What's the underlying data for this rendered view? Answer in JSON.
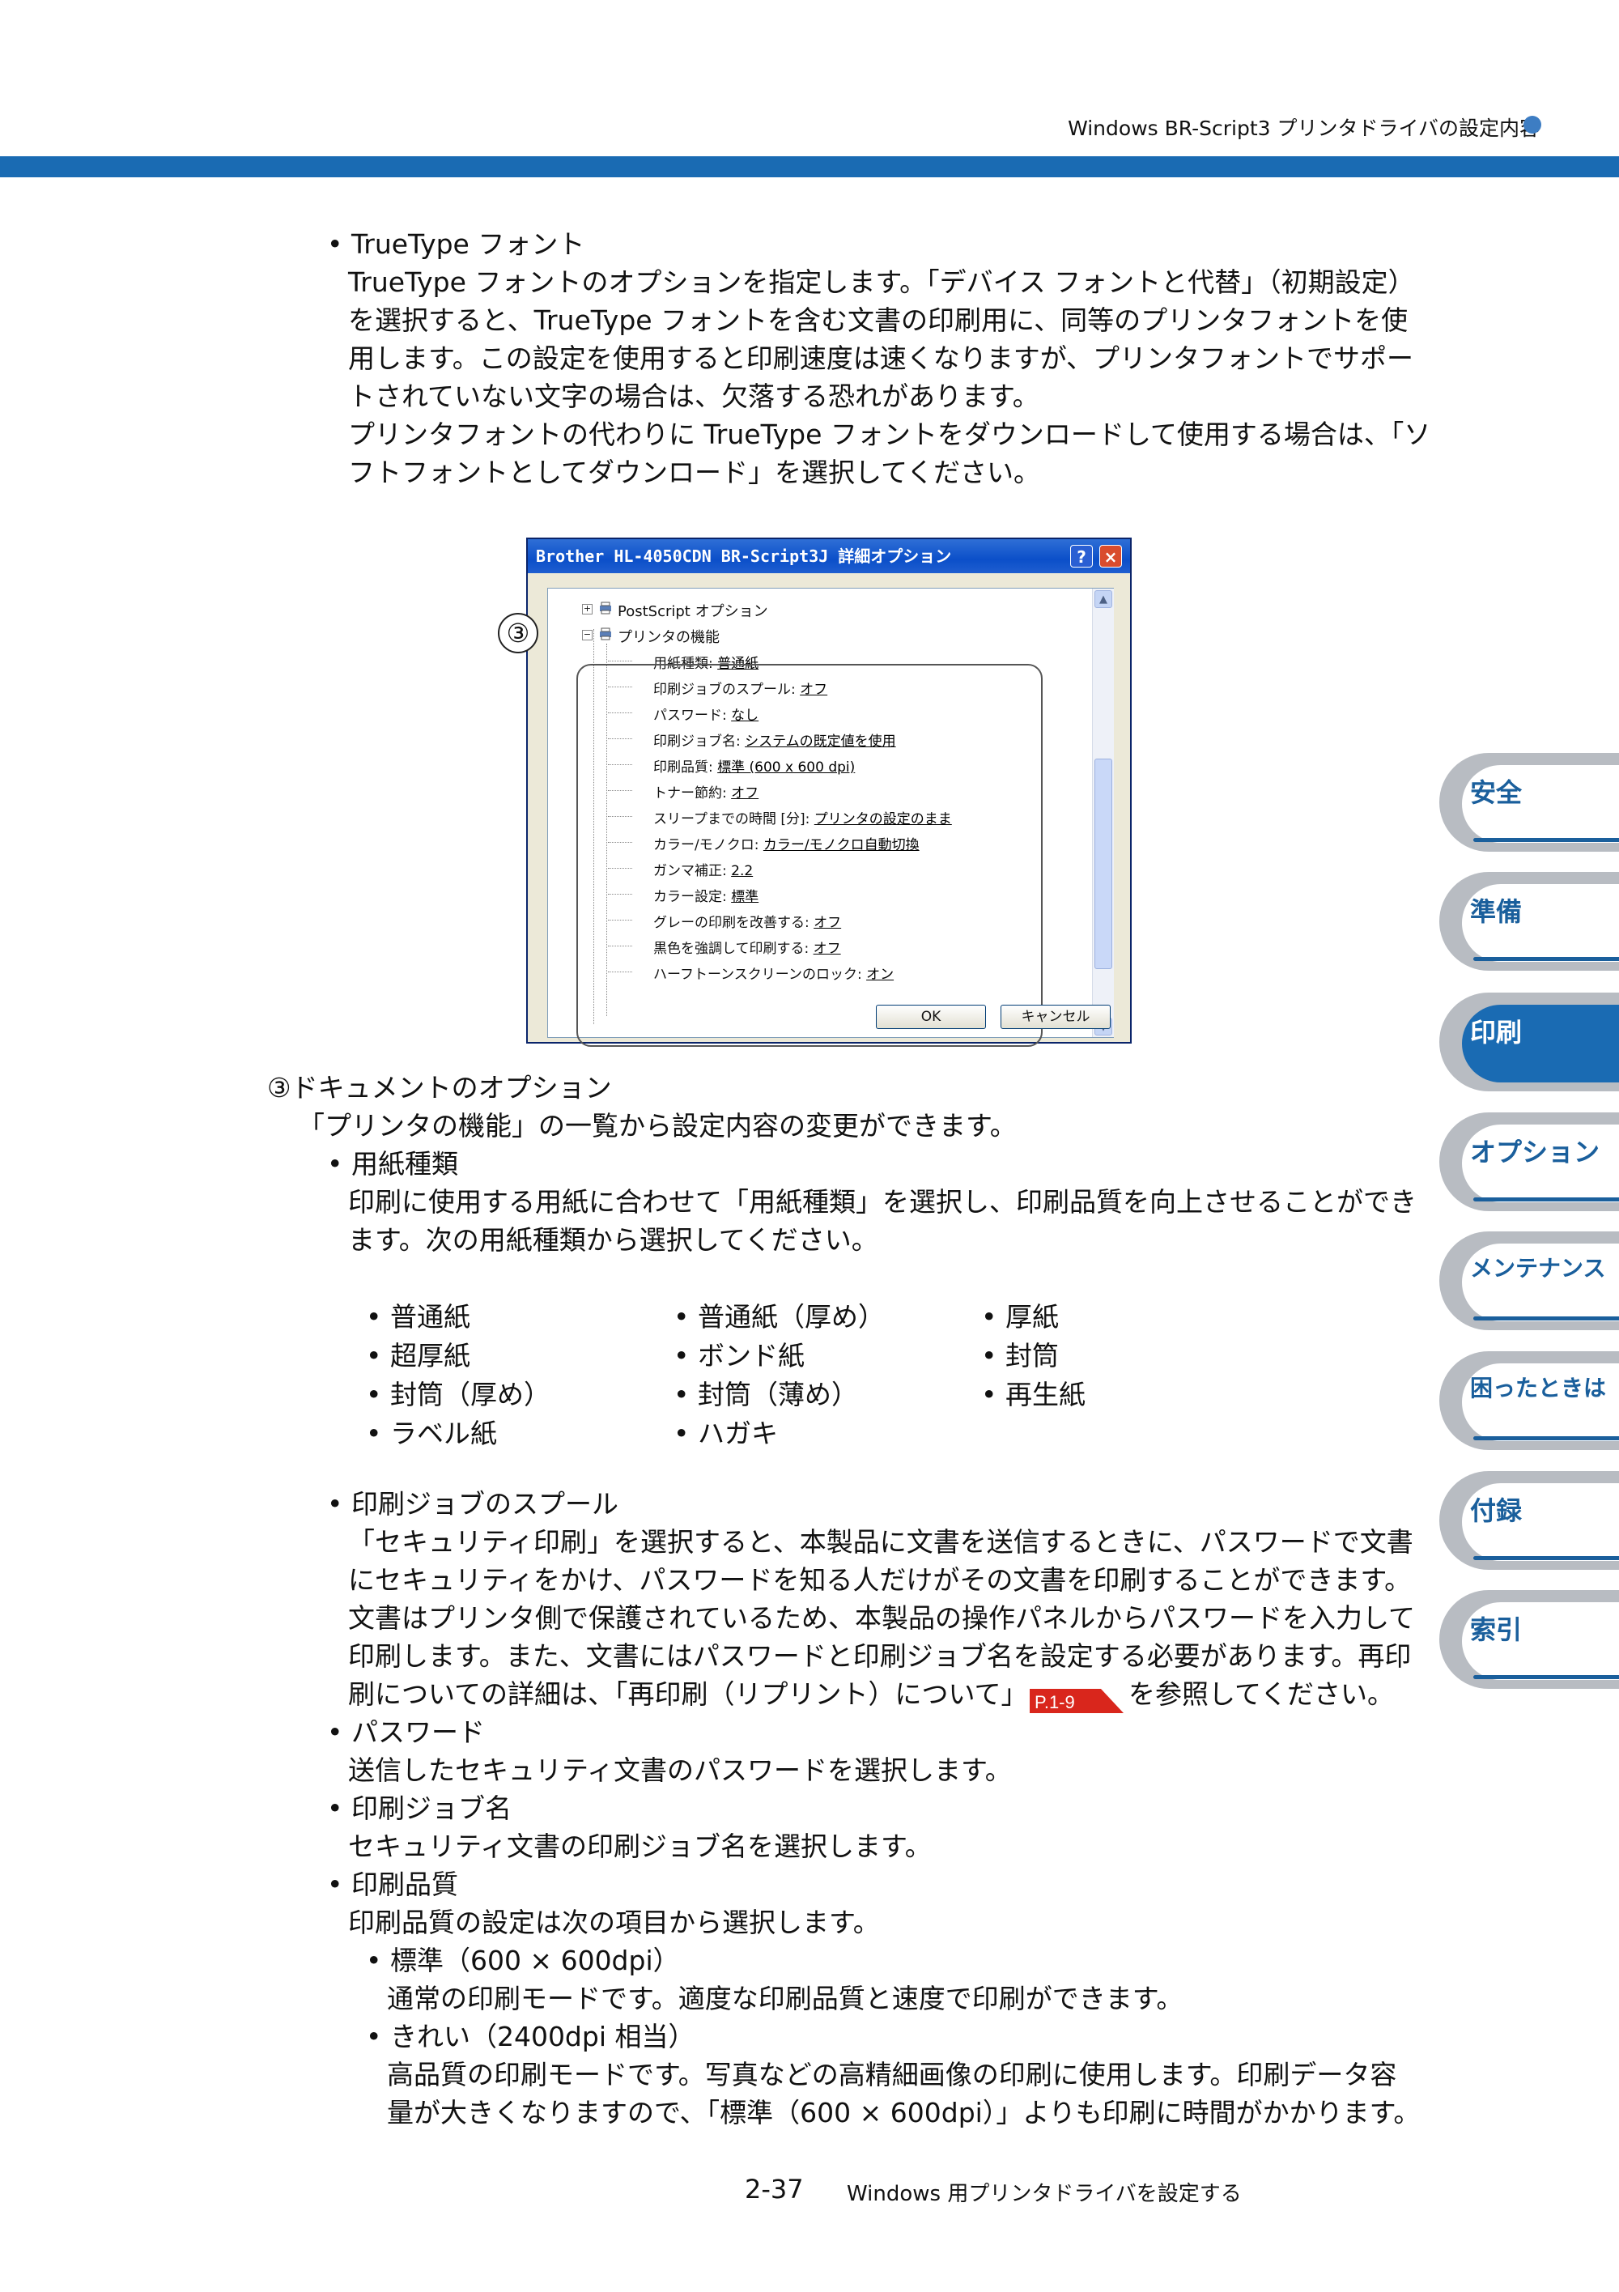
{
  "header": {
    "title": "Windows BR-Script3 プリンタドライバの設定内容"
  },
  "section_truetype": {
    "heading": "• TrueType フォント",
    "lines": [
      "TrueType フォントのオプションを指定します。「デバイス フォントと代替」（初期設定）",
      "を選択すると、TrueType フォントを含む文書の印刷用に、同等のプリンタフォントを使",
      "用します。この設定を使用すると印刷速度は速くなりますが、プリンタフォントでサポー",
      "トされていない文字の場合は、欠落する恐れがあります。",
      "プリンタフォントの代わりに TrueType フォントをダウンロードして使用する場合は、「ソ",
      "フトフォントとしてダウンロード」を選択してください。"
    ]
  },
  "dialog": {
    "title": "Brother HL-4050CDN BR-Script3J 詳細オプション",
    "help": "?",
    "close": "×",
    "callout": "③",
    "tree_top": "PostScript オプション",
    "tree_parent": "プリンタの機能",
    "items": [
      {
        "label": "用紙種類:",
        "value": "普通紙"
      },
      {
        "label": "印刷ジョブのスプール:",
        "value": "オフ"
      },
      {
        "label": "パスワード:",
        "value": "なし"
      },
      {
        "label": "印刷ジョブ名:",
        "value": "システムの既定値を使用"
      },
      {
        "label": "印刷品質:",
        "value": "標準 (600 x 600 dpi)"
      },
      {
        "label": "トナー節約:",
        "value": "オフ"
      },
      {
        "label": "スリープまでの時間 [分]:",
        "value": "プリンタの設定のまま"
      },
      {
        "label": "カラー/モノクロ:",
        "value": "カラー/モノクロ自動切換"
      },
      {
        "label": "ガンマ補正:",
        "value": "2.2"
      },
      {
        "label": "カラー設定:",
        "value": "標準"
      },
      {
        "label": "グレーの印刷を改善する:",
        "value": "オフ"
      },
      {
        "label": "黒色を強調して印刷する:",
        "value": "オフ"
      },
      {
        "label": "ハーフトーンスクリーンのロック:",
        "value": "オン"
      }
    ],
    "ok": "OK",
    "cancel": "キャンセル"
  },
  "section_document": {
    "heading": "③ドキュメントのオプション",
    "intro": "「プリンタの機能」の一覧から設定内容の変更ができます。",
    "paper_heading": "• 用紙種類",
    "paper_lines": [
      "印刷に使用する用紙に合わせて「用紙種類」を選択し、印刷品質を向上させることができ",
      "ます。次の用紙種類から選択してください。"
    ],
    "paper_types": [
      [
        "• 普通紙",
        "• 普通紙（厚め）",
        "• 厚紙"
      ],
      [
        "• 超厚紙",
        "• ボンド紙",
        "• 封筒"
      ],
      [
        "• 封筒（厚め）",
        "• 封筒（薄め）",
        "• 再生紙"
      ],
      [
        "• ラベル紙",
        "• ハガキ",
        ""
      ]
    ],
    "spool_heading": "• 印刷ジョブのスプール",
    "spool_lines": [
      "「セキュリティ印刷」を選択すると、本製品に文書を送信するときに、パスワードで文書",
      "にセキュリティをかけ、パスワードを知る人だけがその文書を印刷することができます。",
      "文書はプリンタ側で保護されているため、本製品の操作パネルからパスワードを入力して",
      "印刷します。また、文書にはパスワードと印刷ジョブ名を設定する必要があります。再印"
    ],
    "spool_last_a": "刷についての詳細は、「再印刷（リプリント）について」",
    "spool_ref": "P.1-9",
    "spool_last_b": "を参照してください。",
    "password_heading": "• パスワード",
    "password_text": "送信したセキュリティ文書のパスワードを選択します。",
    "jobname_heading": "• 印刷ジョブ名",
    "jobname_text": "セキュリティ文書の印刷ジョブ名を選択します。",
    "quality_heading": "• 印刷品質",
    "quality_text": "印刷品質の設定は次の項目から選択します。",
    "standard_heading": "• 標準（600 × 600dpi）",
    "standard_text": "通常の印刷モードです。適度な印刷品質と速度で印刷ができます。",
    "fine_heading": "• きれい（2400dpi 相当）",
    "fine_lines": [
      "高品質の印刷モードです。写真などの高精細画像の印刷に使用します。印刷データ容",
      "量が大きくなりますので、「標準（600 × 600dpi）」よりも印刷に時間がかかります。"
    ]
  },
  "side_tabs": [
    {
      "label": "安全",
      "active": false
    },
    {
      "label": "準備",
      "active": false
    },
    {
      "label": "印刷",
      "active": true
    },
    {
      "label": "オプション",
      "active": false
    },
    {
      "label": "メンテナンス",
      "active": false
    },
    {
      "label": "困ったときは",
      "active": false
    },
    {
      "label": "付録",
      "active": false
    },
    {
      "label": "索引",
      "active": false
    }
  ],
  "footer": {
    "page": "2-37",
    "text": "Windows 用プリンタドライバを設定する"
  },
  "colors": {
    "accent": "#1a6bb3",
    "tab_gray": "#b8bcc2",
    "ref_red": "#d9261c"
  }
}
